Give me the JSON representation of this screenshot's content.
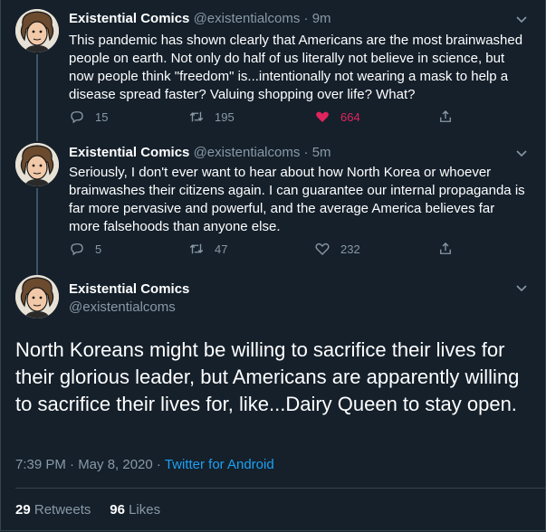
{
  "tweets": [
    {
      "name": "Existential Comics",
      "handle": "@existentialcoms",
      "separator": "·",
      "time": "9m",
      "text": "This pandemic has shown clearly that Americans are the most brainwashed people on earth. Not only do half of us literally not believe in science, but now people think \"freedom\" is...intentionally not wearing a mask to help a disease spread faster? Valuing shopping over life? What?",
      "replies": "15",
      "retweets": "195",
      "likes": "664",
      "liked": true
    },
    {
      "name": "Existential Comics",
      "handle": "@existentialcoms",
      "separator": "·",
      "time": "5m",
      "text": "Seriously, I don't ever want to hear about how North Korea or whoever brainwashes their citizens again. I can guarantee our internal propaganda is far more pervasive and powerful, and the average America believes far more falsehoods than anyone else.",
      "replies": "5",
      "retweets": "47",
      "likes": "232",
      "liked": false
    }
  ],
  "main_tweet": {
    "name": "Existential Comics",
    "handle": "@existentialcoms",
    "text": "North Koreans might be willing to sacrifice their lives for their glorious leader, but Americans are apparently willing to sacrifice their lives for, like...Dairy Queen to stay open.",
    "timestamp": "7:39 PM · May 8, 2020 · ",
    "source": "Twitter for Android",
    "retweet_count": "29",
    "retweet_label": "Retweets",
    "like_count": "96",
    "like_label": "Likes"
  },
  "icons": {
    "reply": "reply-icon",
    "retweet": "retweet-icon",
    "like": "heart-icon",
    "share": "share-icon",
    "more": "chevron-down-icon"
  },
  "colors": {
    "background": "#15202b",
    "secondary_text": "#8899a6",
    "like_active": "#e0245e",
    "link": "#1da1f2"
  }
}
